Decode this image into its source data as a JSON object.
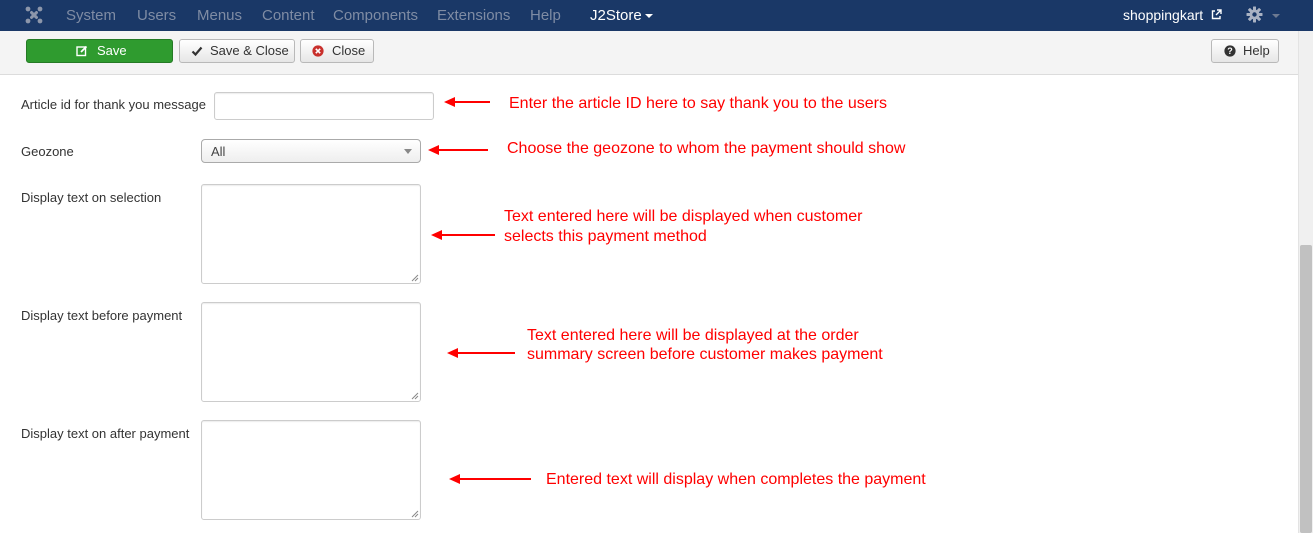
{
  "navbar": {
    "logo_icon": "joomla-logo-icon",
    "menu": [
      "System",
      "Users",
      "Menus",
      "Content",
      "Components",
      "Extensions",
      "Help"
    ],
    "active_menu": "J2Store",
    "site_link": "shoppingkart",
    "colors": {
      "background": "#1a3867",
      "muted_text": "#7f8ca4",
      "active_text": "#ffffff"
    }
  },
  "toolbar": {
    "save_label": "Save",
    "save_close_label": "Save & Close",
    "close_label": "Close",
    "help_label": "Help",
    "colors": {
      "save_bg": "#2f9b2f",
      "close_icon": "#c9302c"
    }
  },
  "form": {
    "article_id_label": "Article id for thank you message",
    "article_id_value": "",
    "geozone_label": "Geozone",
    "geozone_value": "All",
    "display_selection_label": "Display text on selection",
    "display_before_label": "Display text before payment",
    "display_after_label": "Display text on after payment"
  },
  "annotations": {
    "article": "Enter the article ID here to say thank you to the users",
    "geozone": "Choose the geozone to whom the payment should show",
    "selection_line1": "Text entered here will be displayed when customer",
    "selection_line2": "selects this payment method",
    "before_line1": "Text entered here will be displayed at the order",
    "before_line2": "summary screen before customer makes payment",
    "after": "Entered text will display when completes the payment",
    "color": "#ff0000"
  }
}
